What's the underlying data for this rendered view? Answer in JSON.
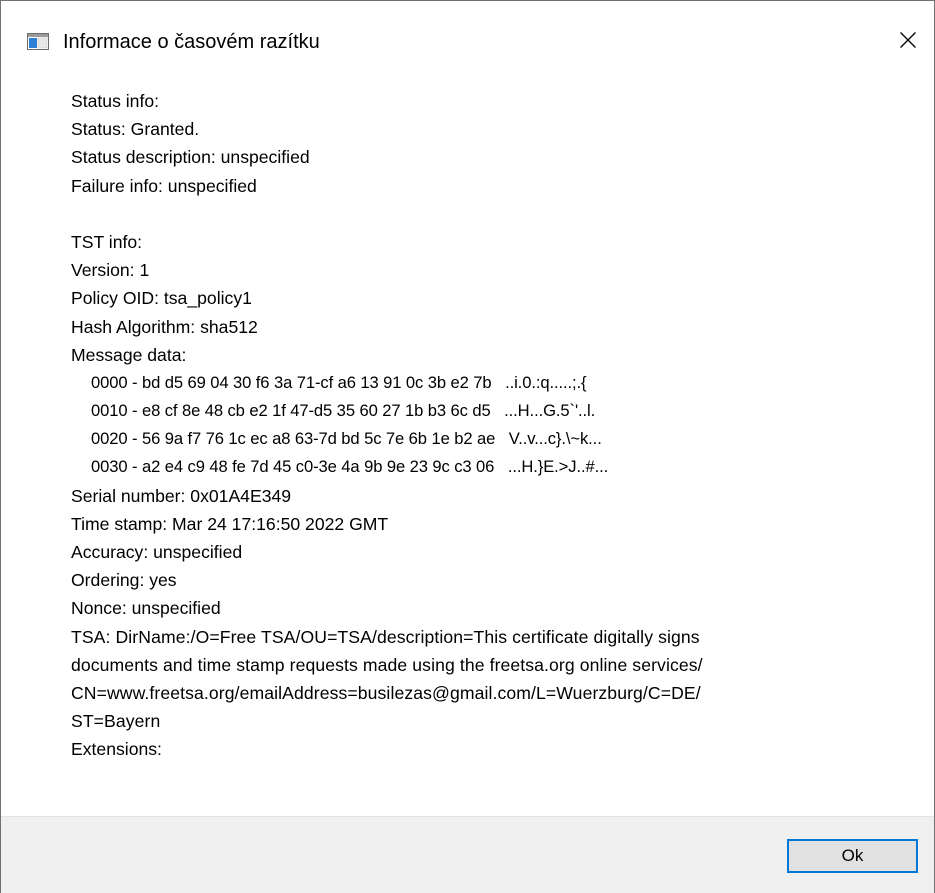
{
  "window": {
    "title": "Informace o časovém razítku",
    "app_icon": "window-app-icon",
    "close_icon": "close-icon"
  },
  "status": {
    "heading": "Status info:",
    "status": "Status: Granted.",
    "description": "Status description: unspecified",
    "failure": "Failure info: unspecified"
  },
  "tst": {
    "heading": "TST info:",
    "version": "Version: 1",
    "policy": "Policy OID: tsa_policy1",
    "hash": "Hash Algorithm: sha512",
    "message_heading": "Message data:",
    "message_lines": [
      "0000 - bd d5 69 04 30 f6 3a 71-cf a6 13 91 0c 3b e2 7b   ..i.0.:q.....;.{",
      "0010 - e8 cf 8e 48 cb e2 1f 47-d5 35 60 27 1b b3 6c d5   ...H...G.5`'..l.",
      "0020 - 56 9a f7 76 1c ec a8 63-7d bd 5c 7e 6b 1e b2 ae   V..v...c}.\\~k...",
      "0030 - a2 e4 c9 48 fe 7d 45 c0-3e 4a 9b 9e 23 9c c3 06   ...H.}E.>J..#..."
    ],
    "serial": "Serial number: 0x01A4E349",
    "timestamp": "Time stamp: Mar 24 17:16:50 2022 GMT",
    "accuracy": "Accuracy: unspecified",
    "ordering": "Ordering: yes",
    "nonce": "Nonce: unspecified",
    "tsa_lines": [
      "TSA: DirName:/O=Free TSA/OU=TSA/description=This certificate digitally signs",
      "documents and time stamp requests made using the freetsa.org online services/",
      "CN=www.freetsa.org/emailAddress=busilezas@gmail.com/L=Wuerzburg/C=DE/",
      "ST=Bayern"
    ],
    "extensions": "Extensions:"
  },
  "footer": {
    "ok_label": "Ok"
  }
}
